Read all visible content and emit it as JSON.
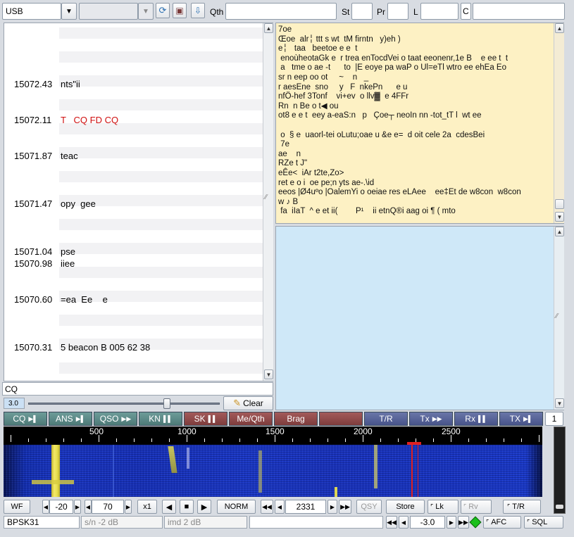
{
  "toolbar": {
    "mode_value": "USB",
    "qth_label": "Qth",
    "st_label": "St",
    "pr_label": "Pr",
    "l_label": "L",
    "c_label": "C"
  },
  "rx_list": [
    {
      "freq": "15072.43",
      "text": "nts\"ii",
      "color": "#000000"
    },
    {
      "freq": "15072.11",
      "text": "T   CQ FD CQ",
      "color": "#d01010"
    },
    {
      "freq": "15071.87",
      "text": "teac",
      "color": "#000000"
    },
    {
      "freq": "15071.47",
      "text": "opy  gee",
      "color": "#000000"
    },
    {
      "freq": "15071.04",
      "text": "pse",
      "color": "#000000"
    },
    {
      "freq": "15070.98",
      "text": "iiee",
      "color": "#000000"
    },
    {
      "freq": "15070.60",
      "text": "=ea  Ee    e",
      "color": "#000000"
    },
    {
      "freq": "15070.31",
      "text": "5 beacon B 005 62 38",
      "color": "#000000"
    }
  ],
  "rx_text": "7oe\nŒoe  alr╎ ttt s wt  tM firntn   y)eh )\ne╎   taa   beetoe e e  t\n enoùheotaGk e  r trea enTocdVei o taat eeonenr,1e B    e ee t  t\n a   tme o ae -t      to  |E eoye pa waP o Ul=eTl wtro ee ehEa Eo\nsr n eep oo ot     ~    n   _\nr aesEne  sno     y   F  nkePn      e u\nnfÖ-hef 3Tonf    vi+ev  o llv▓  e 4FFr\nRn  n Be o t◀ ou\not8 e e t  eey a-eaS:n   p   Çoe┬ neoIn nn -tot_tT l  wt ee\n\n o  § e  uaorl-tei oLutu;oae u &e e=  d oit cele 2a  cdesBei\n 7e\nae    n\nRZe t J\"\neÊe<  iAr t2te,Zo>\nret e o i  oe pe;n yts ae-.\\id\neeos |Ø4uºo |OalemYi o oeiae res eLAee    ee‡Et de w8con  w8con\nw ♪ B\n fa  iIaT  ^ e et ii(        P¹    ii etnQ®i aag oi ¶ ( mto",
  "tx": {
    "input_value": "CQ",
    "squelch_value": "3.0",
    "clear_label": "Clear",
    "level": 0.72
  },
  "macros": [
    {
      "label": "CQ",
      "icon": "▶▌",
      "style": "m-g"
    },
    {
      "label": "ANS",
      "icon": "▶▌",
      "style": "m-g"
    },
    {
      "label": "QSO",
      "icon": "▶▶",
      "style": "m-g"
    },
    {
      "label": "KN",
      "icon": "▌▌",
      "style": "m-g"
    },
    {
      "label": "SK",
      "icon": "▌▌",
      "style": "m-r"
    },
    {
      "label": "Me/Qth",
      "icon": "",
      "style": "m-r"
    },
    {
      "label": "Brag",
      "icon": "",
      "style": "m-r"
    },
    {
      "label": "",
      "icon": "",
      "style": "m-r"
    },
    {
      "label": "T/R",
      "icon": "",
      "style": "m-b"
    },
    {
      "label": "Tx",
      "icon": "▶▶",
      "style": "m-b"
    },
    {
      "label": "Rx",
      "icon": "▌▌",
      "style": "m-b"
    },
    {
      "label": "TX",
      "icon": "▶▌",
      "style": "m-b"
    }
  ],
  "macro_page": "1",
  "scale_ticks": [
    "500",
    "1000",
    "1500",
    "2000",
    "2500"
  ],
  "controls": {
    "wf_label": "WF",
    "ref_value": "-20",
    "range_value": "70",
    "zoom_label": "x1",
    "norm_label": "NORM",
    "freq_value": "2331",
    "qsy_label": "QSY",
    "store_label": "Store",
    "lk_label": "Lk",
    "rv_label": "Rv",
    "tr_label": "T/R"
  },
  "status": {
    "mode": "BPSK31",
    "sn": "s/n -2 dB",
    "imd": "imd  2 dB",
    "offset": "-3.0",
    "afc_label": "AFC",
    "sql_label": "SQL"
  },
  "colors": {
    "rx_panel": "#fdf1c4",
    "tx_panel": "#cfe8f8",
    "waterfall_bg": "#1a2fa8",
    "signal": "#f2e84a",
    "cursor": "#e02020"
  }
}
